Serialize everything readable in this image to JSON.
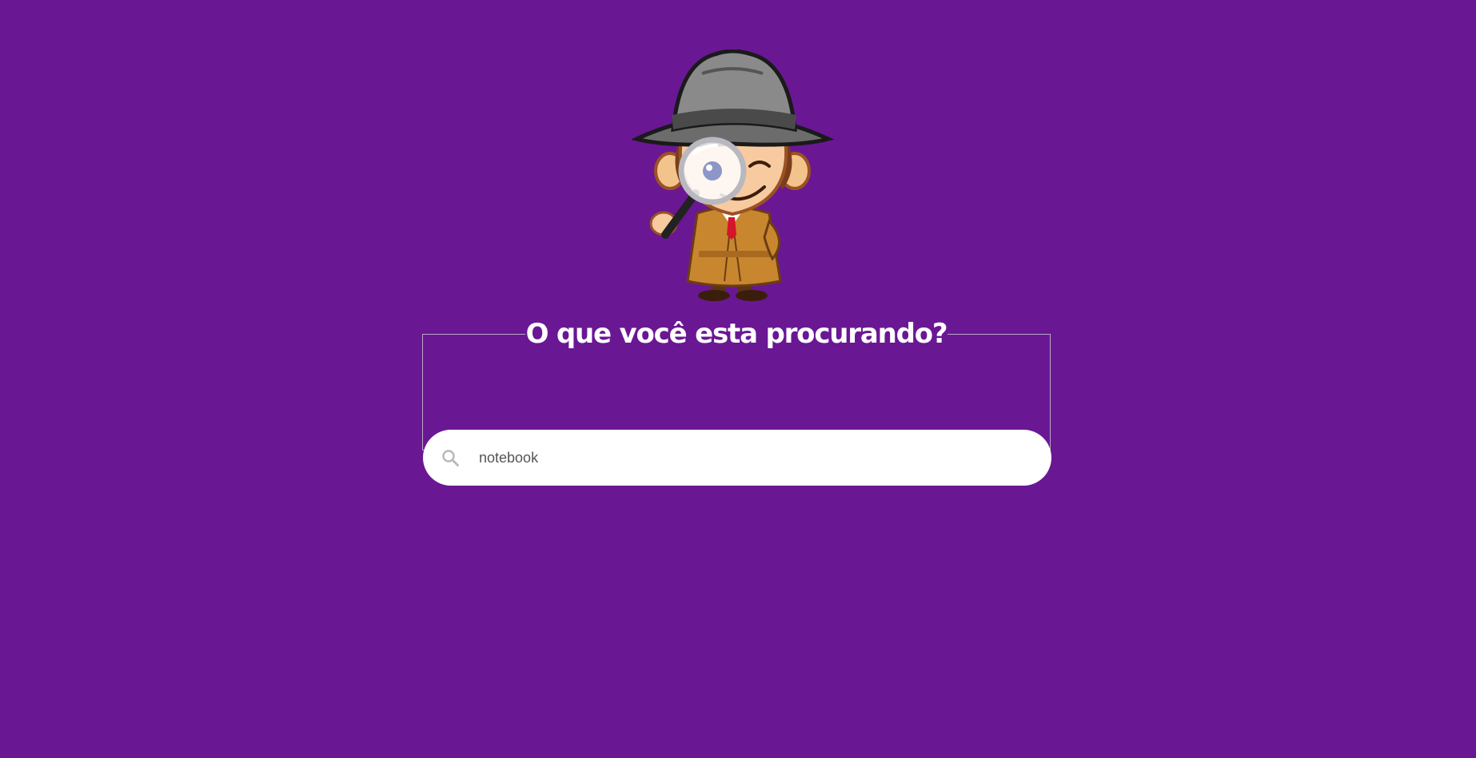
{
  "page": {
    "background_color": "#6a1794"
  },
  "mascot": {
    "icon": "detective-mascot-icon"
  },
  "search": {
    "heading": "O que você esta procurando?",
    "value": "notebook",
    "icon": "search-icon"
  }
}
